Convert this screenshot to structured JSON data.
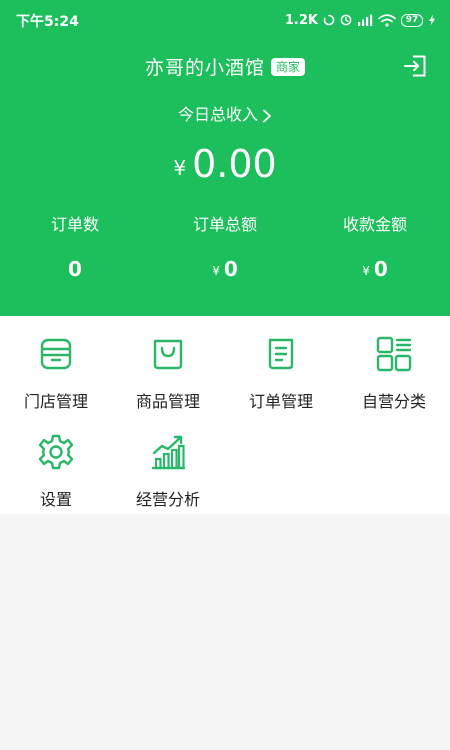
{
  "status_bar": {
    "time": "下午5:24",
    "network_speed": "1.2K",
    "battery": "97"
  },
  "header": {
    "shop_name": "亦哥的小酒馆",
    "badge": "商家",
    "today_income_label": "今日总收入",
    "currency_symbol": "¥",
    "total_income": "0.00",
    "stats": [
      {
        "label": "订单数",
        "value": "0",
        "has_currency": false
      },
      {
        "label": "订单总额",
        "value": "0",
        "has_currency": true
      },
      {
        "label": "收款金额",
        "value": "0",
        "has_currency": true
      }
    ]
  },
  "menu": {
    "items": [
      {
        "label": "门店管理",
        "icon": "store-icon"
      },
      {
        "label": "商品管理",
        "icon": "shopping-bag-icon"
      },
      {
        "label": "订单管理",
        "icon": "order-document-icon"
      },
      {
        "label": "自营分类",
        "icon": "category-grid-icon"
      },
      {
        "label": "设置",
        "icon": "gear-icon"
      },
      {
        "label": "经营分析",
        "icon": "growth-chart-icon"
      }
    ]
  },
  "colors": {
    "brand_green": "#1dbf5c",
    "icon_green": "#2bb76a"
  }
}
